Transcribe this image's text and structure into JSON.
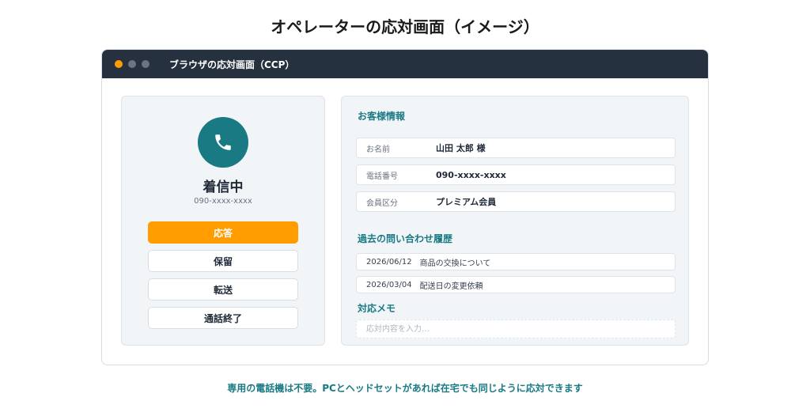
{
  "page": {
    "title": "オペレーターの応対画面（イメージ）",
    "footer": "専用の電話機は不要。PCとヘッドセットがあれば在宅でも同じように応対できます"
  },
  "window": {
    "title": "ブラウザの応対画面（CCP）",
    "dots": [
      "#ff9c00",
      "#6b7480",
      "#6b7480"
    ]
  },
  "call": {
    "icon": "phone-icon",
    "status": "着信中",
    "caller": "090-xxxx-xxxx",
    "buttons": {
      "answer": "応答",
      "hold": "保留",
      "transfer": "転送",
      "end": "通話終了"
    }
  },
  "customer": {
    "section_title": "お客様情報",
    "rows": [
      {
        "label": "お名前",
        "value": "山田 太郎 様"
      },
      {
        "label": "電話番号",
        "value": "090-xxxx-xxxx"
      },
      {
        "label": "会員区分",
        "value": "プレミアム会員"
      }
    ]
  },
  "history": {
    "section_title": "過去の問い合わせ履歴",
    "items": [
      {
        "date": "2026/06/12",
        "text": "商品の交換について"
      },
      {
        "date": "2026/03/04",
        "text": "配送日の変更依頼"
      }
    ]
  },
  "memo": {
    "section_title": "対応メモ",
    "placeholder": "応対内容を入力…",
    "value": ""
  },
  "colors": {
    "accent": "#197a84",
    "primary_button": "#ff9c00",
    "titlebar": "#26313f"
  }
}
